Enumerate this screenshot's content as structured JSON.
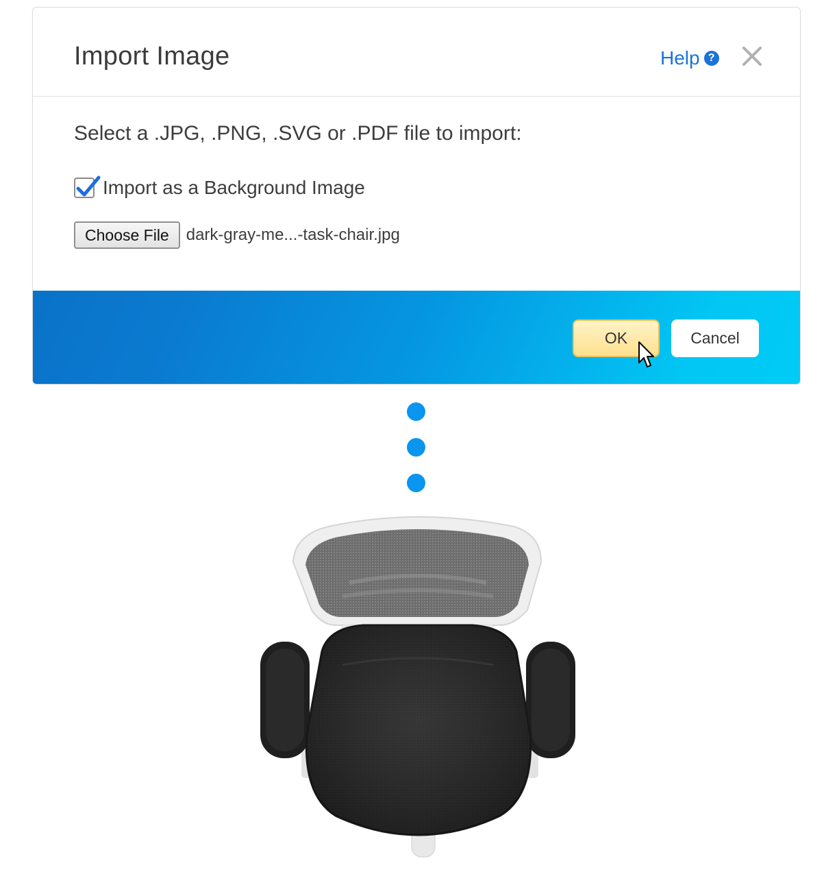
{
  "dialog": {
    "title": "Import Image",
    "help_label": "Help",
    "help_icon": "question-circle-icon",
    "close_icon": "close-icon",
    "prompt": "Select a .JPG, .PNG, .SVG or .PDF file to import:",
    "checkbox_label": "Import as a Background Image",
    "checkbox_checked": true,
    "choose_file_label": "Choose File",
    "file_name": "dark-gray-me...-task-chair.jpg",
    "ok_label": "OK",
    "cancel_label": "Cancel"
  },
  "colors": {
    "accent": "#1a73d9",
    "footer_gradient_start": "#0a72c8",
    "footer_gradient_end": "#00cbf7",
    "ok_fill": "#fde08f",
    "dot": "#0a95ef"
  },
  "illustration": {
    "dots_count": 3,
    "image": "office-chair-top-view"
  }
}
